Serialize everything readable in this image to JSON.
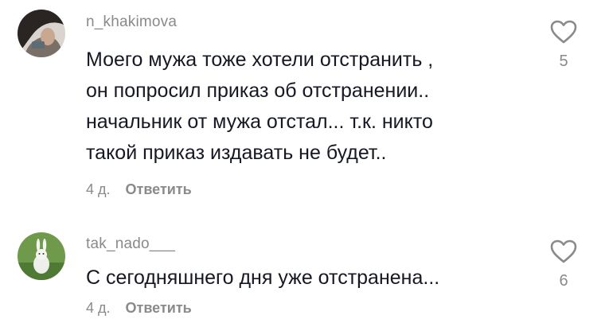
{
  "comments": [
    {
      "username": "n_khakimova",
      "lines": [
        "Моего мужа тоже хотели отстранить ,",
        "он попросил приказ об отстранении..",
        "начальник от мужа отстал... т.к. никто",
        "такой приказ издавать не будет.."
      ],
      "time": "4 д.",
      "reply_label": "Ответить",
      "likes": "5",
      "like_icon": "heart-outline-icon"
    },
    {
      "username": "tak_nado___",
      "lines": [
        "С сегодняшнего дня уже отстранена..."
      ],
      "time": "4 д.",
      "reply_label": "Ответить",
      "likes": "6",
      "like_icon": "heart-outline-icon"
    }
  ],
  "colors": {
    "text": "#161823",
    "secondary": "#8a8a8a",
    "background": "#ffffff"
  }
}
